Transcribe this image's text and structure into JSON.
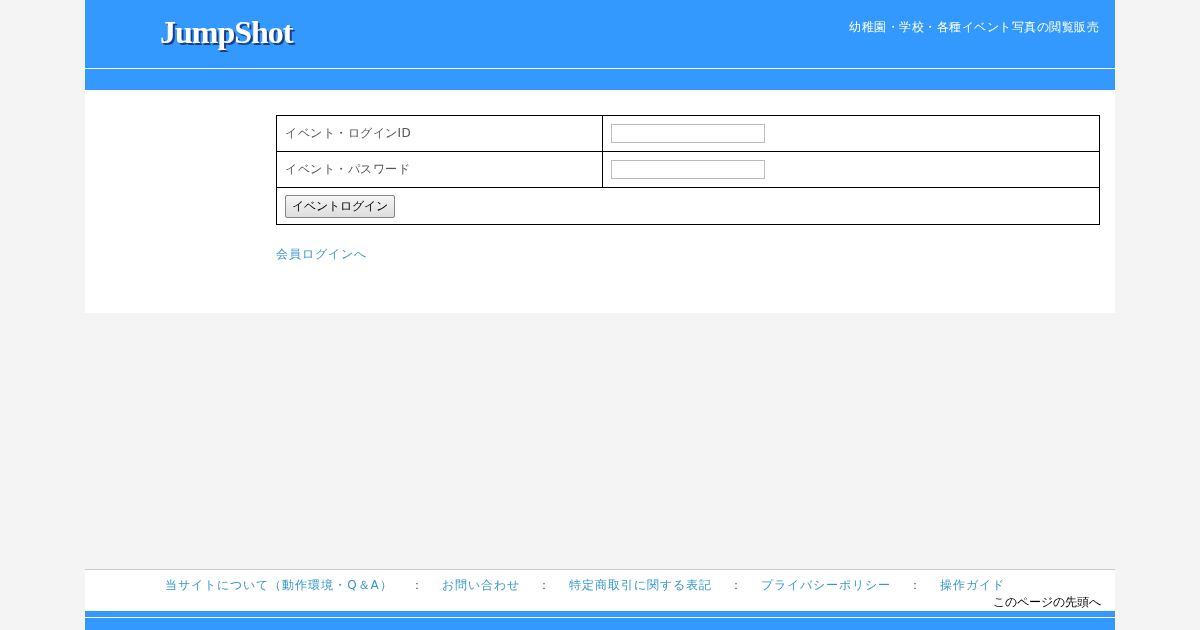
{
  "header": {
    "logo": "JumpShot",
    "tagline": "幼稚園・学校・各種イベント写真の閲覧販売"
  },
  "login_form": {
    "fields": [
      {
        "label": "イベント・ログインID"
      },
      {
        "label": "イベント・パスワード"
      }
    ],
    "button": "イベントログイン"
  },
  "member_login_link": "会員ログインへ",
  "footer": {
    "links": [
      "当サイトについて（動作環境・Q＆A）",
      "お問い合わせ",
      "特定商取引に関する表記",
      "プライバシーポリシー",
      "操作ガイド"
    ],
    "separator": "：",
    "page_top": "このページの先頭へ"
  }
}
